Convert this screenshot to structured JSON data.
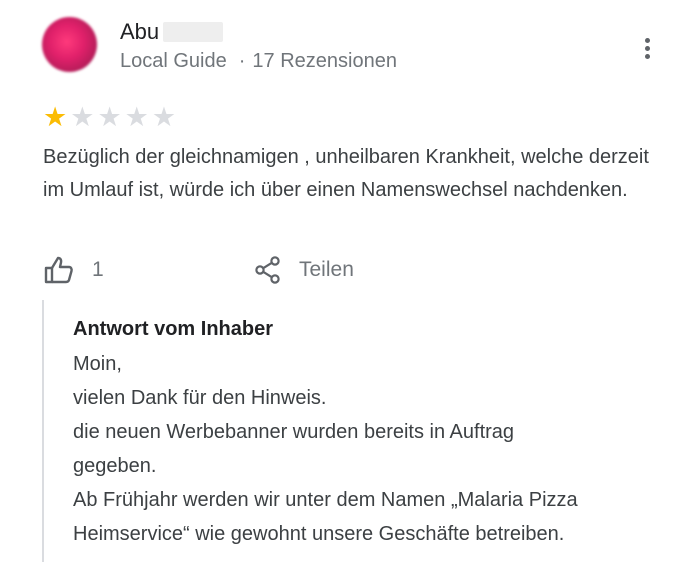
{
  "reviewer": {
    "name": "Abu",
    "badge": "Local Guide",
    "separator": "·",
    "reviews_count": "17 Rezensionen",
    "avatar_icon": "user-avatar-blurred",
    "name_redacted": true
  },
  "more_icon": "vertical-dots-icon",
  "rating": {
    "value": 1,
    "max": 5,
    "filled_color": "#fbbc04",
    "empty_color": "#dadce0"
  },
  "review": {
    "text": "Bezüglich der gleichnamigen , unheilbaren Krankheit, welche derzeit im Umlauf ist, würde ich über einen Namenswechsel nachdenken."
  },
  "actions": {
    "like_icon": "thumbs-up-icon",
    "like_count": "1",
    "share_icon": "share-icon",
    "share_label": "Teilen"
  },
  "owner_response": {
    "title": "Antwort vom Inhaber",
    "text": "Moin,\nvielen Dank für den Hinweis.\ndie neuen Werbebanner wurden bereits in Auftrag\ngegeben.\nAb Frühjahr werden wir unter dem Namen „Malaria Pizza\nHeimservice“ wie gewohnt unsere Geschäfte betreiben."
  }
}
